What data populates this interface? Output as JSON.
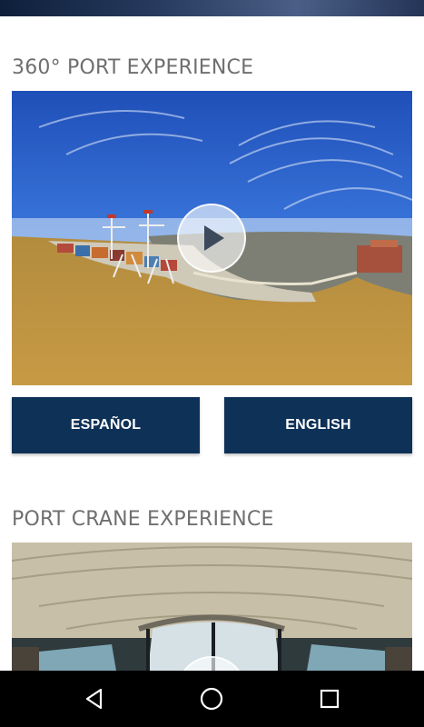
{
  "sections": [
    {
      "title": "360° PORT EXPERIENCE",
      "buttons": [
        {
          "label": "ESPAÑOL"
        },
        {
          "label": "ENGLISH"
        }
      ]
    },
    {
      "title": "PORT CRANE EXPERIENCE"
    }
  ],
  "icons": {
    "play": "play-icon",
    "back": "back-icon",
    "home": "home-icon",
    "recents": "recents-icon"
  },
  "colors": {
    "button_bg": "#0e3157",
    "button_text": "#ffffff",
    "title_text": "#6f6f6f",
    "navbar_bg": "#000000"
  }
}
